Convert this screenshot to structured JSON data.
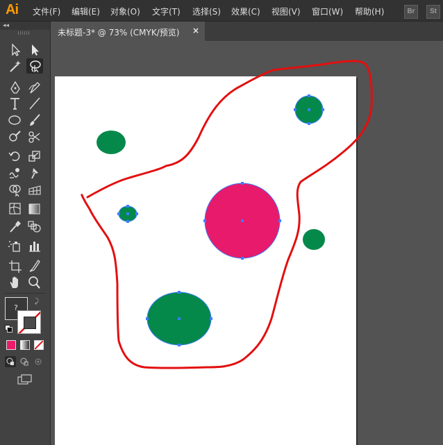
{
  "app": {
    "logo": "Ai"
  },
  "menu": [
    {
      "label": "文件(F)"
    },
    {
      "label": "编辑(E)"
    },
    {
      "label": "对象(O)"
    },
    {
      "label": "文字(T)"
    },
    {
      "label": "选择(S)"
    },
    {
      "label": "效果(C)"
    },
    {
      "label": "视图(V)"
    },
    {
      "label": "窗口(W)"
    },
    {
      "label": "帮助(H)"
    }
  ],
  "app_switcher": [
    {
      "label": "Br"
    },
    {
      "label": "St"
    }
  ],
  "tools_panel": {
    "collapse_label": "◂◂",
    "tools": [
      {
        "name": "selection-tool-icon"
      },
      {
        "name": "direct-selection-tool-icon"
      },
      {
        "name": "magic-wand-tool-icon"
      },
      {
        "name": "lasso-tool-icon",
        "active": true
      },
      {
        "name": "pen-tool-icon"
      },
      {
        "name": "curvature-tool-icon"
      },
      {
        "name": "type-tool-icon"
      },
      {
        "name": "line-segment-tool-icon"
      },
      {
        "name": "ellipse-tool-icon"
      },
      {
        "name": "paintbrush-tool-icon"
      },
      {
        "name": "shaper-tool-icon"
      },
      {
        "name": "scissors-tool-icon"
      },
      {
        "name": "rotate-tool-icon"
      },
      {
        "name": "scale-tool-icon"
      },
      {
        "name": "warp-tool-icon"
      },
      {
        "name": "puppet-warp-tool-icon"
      },
      {
        "name": "shape-builder-tool-icon"
      },
      {
        "name": "perspective-grid-tool-icon"
      },
      {
        "name": "mesh-tool-icon"
      },
      {
        "name": "gradient-tool-icon"
      },
      {
        "name": "eyedropper-tool-icon"
      },
      {
        "name": "blend-tool-icon"
      },
      {
        "name": "symbol-sprayer-tool-icon"
      },
      {
        "name": "column-graph-tool-icon"
      },
      {
        "name": "artboard-tool-icon"
      },
      {
        "name": "slice-tool-icon"
      },
      {
        "name": "hand-tool-icon"
      },
      {
        "name": "zoom-tool-icon"
      }
    ],
    "fill_stroke_label": "?",
    "fill_color": "#ec1c6c"
  },
  "document_tab": {
    "title": "未标题-3* @ 73% (CMYK/预览)",
    "close_label": "×"
  },
  "colors": {
    "green": "#04894b",
    "magenta": "#e81a6b",
    "lasso_stroke": "#e30f0f",
    "anchor": "#3d7cff"
  },
  "shapes": [
    {
      "name": "small-green-circle-left",
      "selected": false
    },
    {
      "name": "green-circle-top-right",
      "selected": true
    },
    {
      "name": "tiny-green-circle",
      "selected": true
    },
    {
      "name": "magenta-circle",
      "selected": true
    },
    {
      "name": "green-circle-right",
      "selected": false
    },
    {
      "name": "large-green-ellipse",
      "selected": true
    }
  ]
}
